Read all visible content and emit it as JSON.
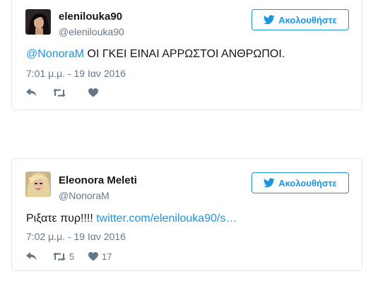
{
  "tweets": [
    {
      "display_name": "elenilouka90",
      "handle": "@elenilouka90",
      "follow_label": "Ακολουθήστε",
      "text_mention": "@NonoraM",
      "text_body": " ΟΙ ΓΚΕΙ ΕΙΝΑΙ ΑΡΡΩΣΤΟΙ ΑΝΘΡΩΠΟΙ.",
      "text_link": "",
      "timestamp": "7:01 μ.μ. - 19 Ιαν 2016",
      "retweet_count": "",
      "like_count": ""
    },
    {
      "display_name": "Eleonora Meleti",
      "handle": "@NonoraM",
      "follow_label": "Ακολουθήστε",
      "text_mention": "",
      "text_body": "Ριξατε πυρ!!!! ",
      "text_link": "twitter.com/elenilouka90/s…",
      "timestamp": "7:02 μ.μ. - 19 Ιαν 2016",
      "retweet_count": "5",
      "like_count": "17"
    }
  ],
  "icons": {
    "bird": "twitter-bird-icon",
    "reply": "reply-icon",
    "retweet": "retweet-icon",
    "like": "heart-icon"
  },
  "colors": {
    "accent": "#1b95e0",
    "muted": "#657786",
    "text": "#14171a",
    "border": "#e1e8ed"
  }
}
